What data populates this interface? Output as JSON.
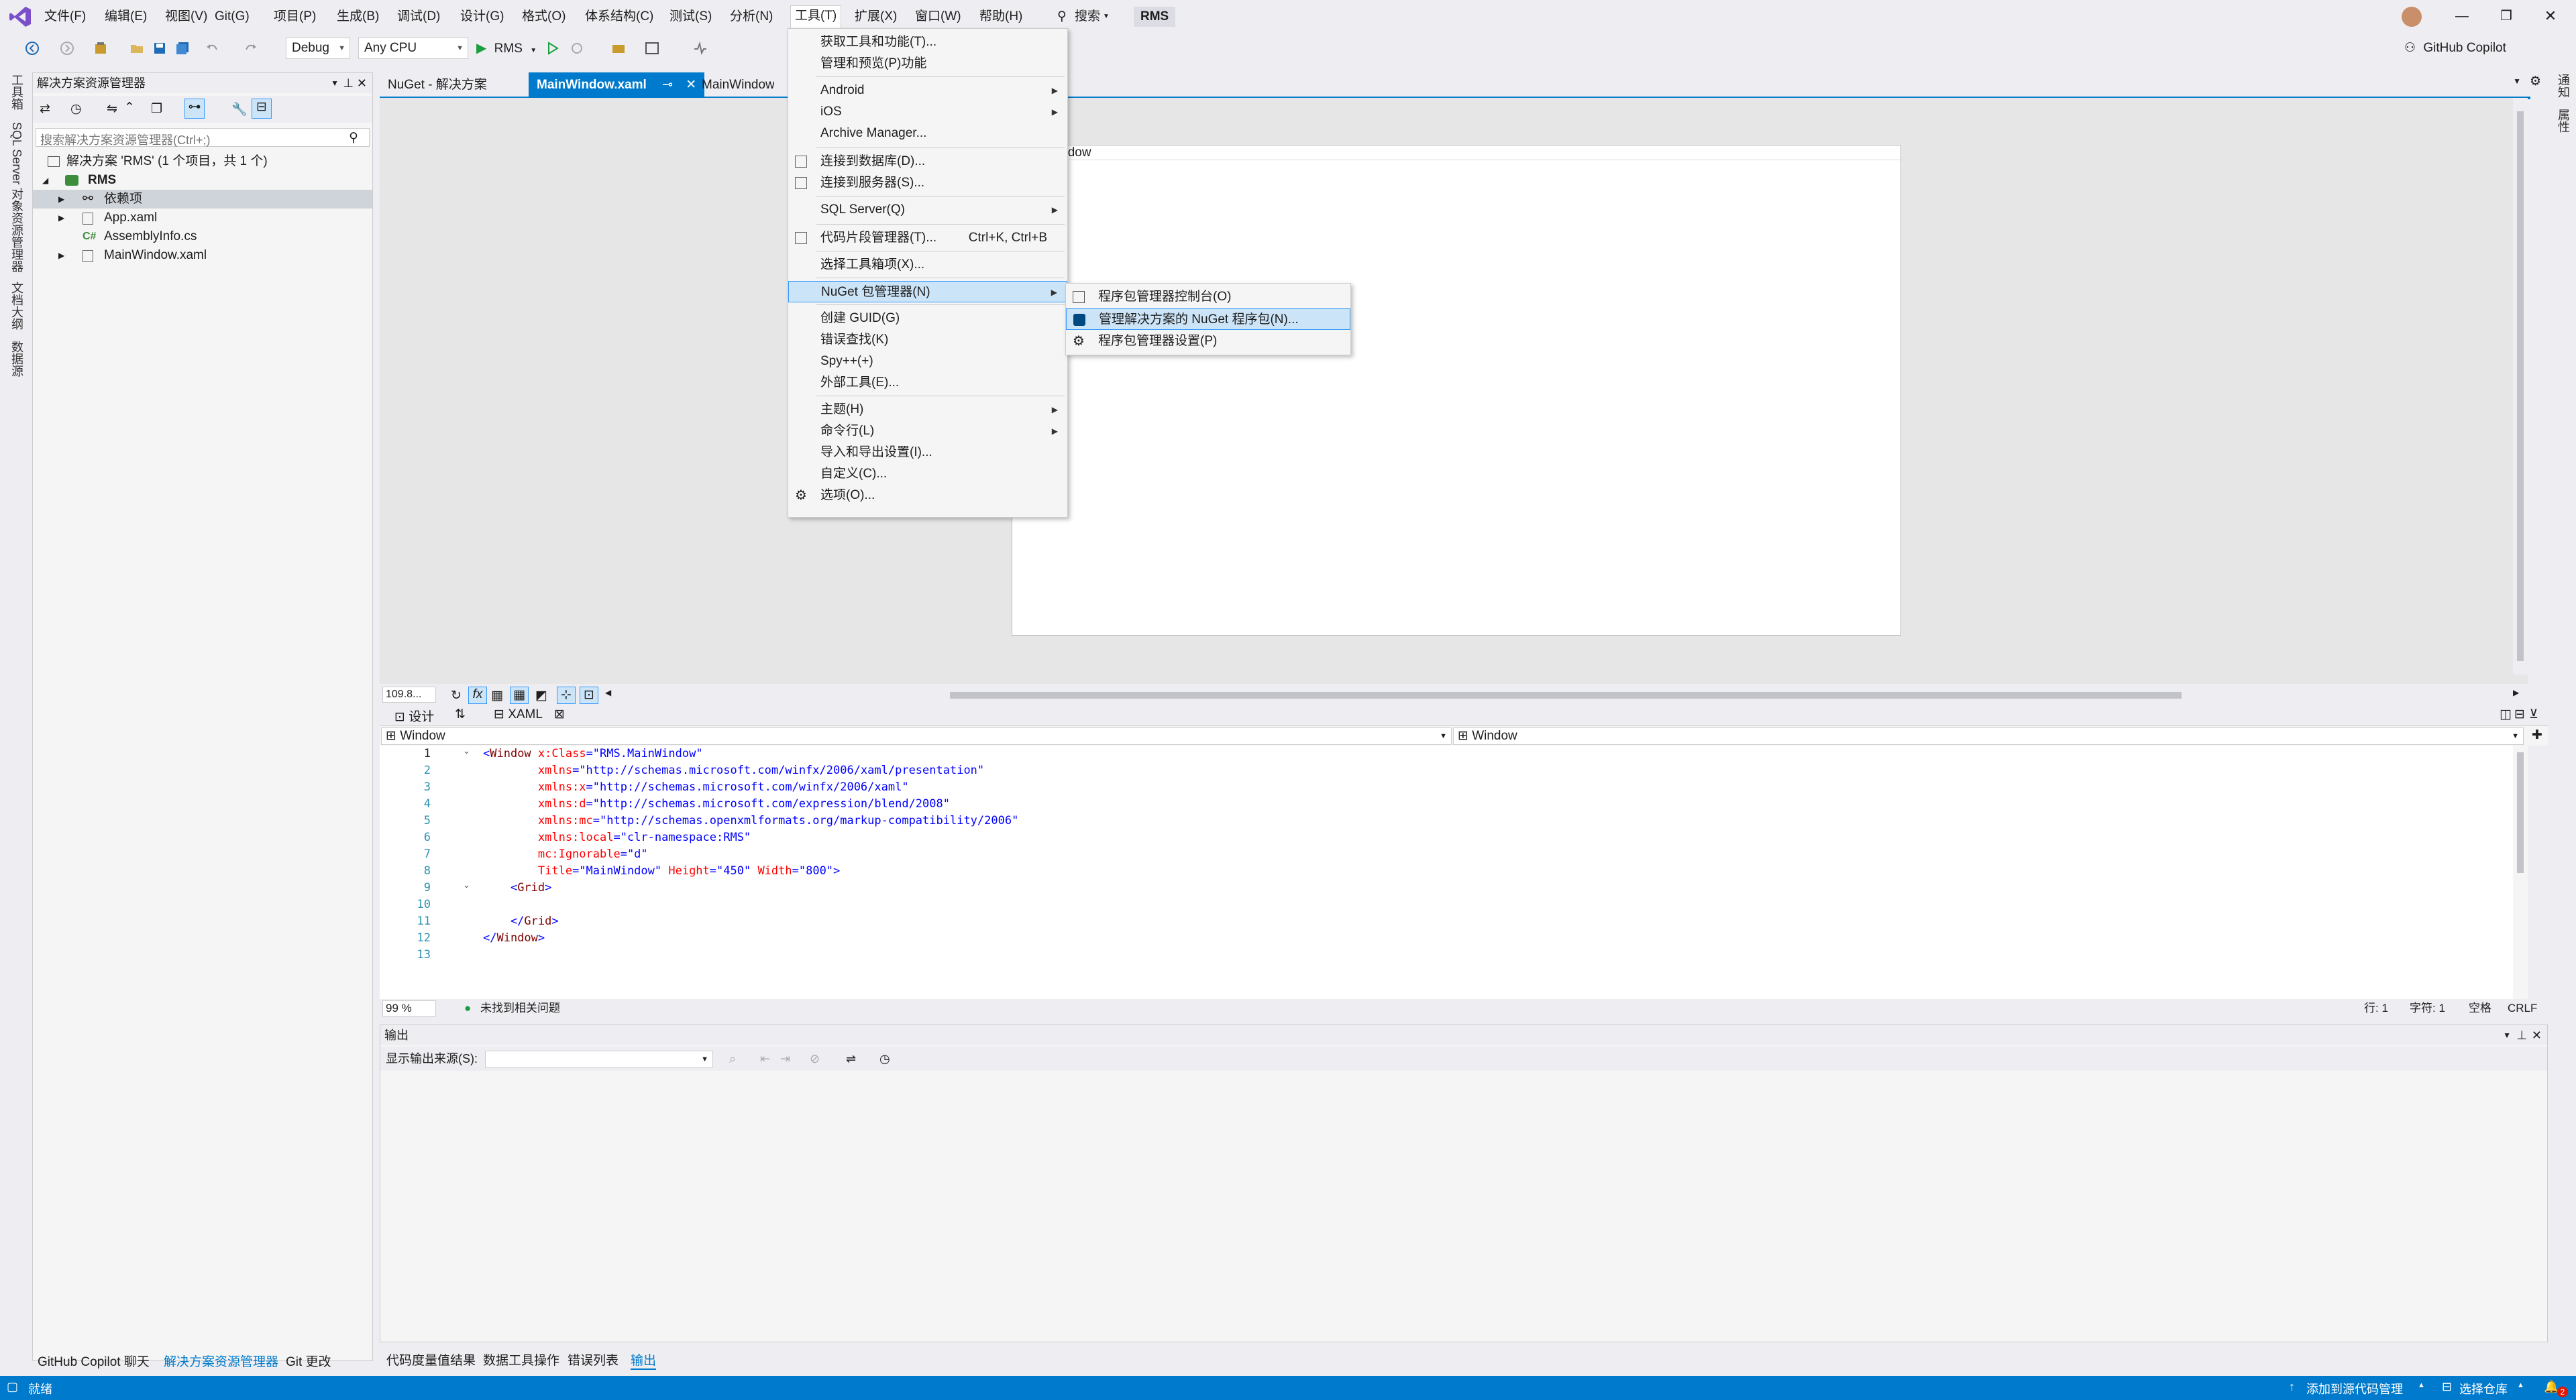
{
  "menubar": {
    "items": [
      "文件(F)",
      "编辑(E)",
      "视图(V)",
      "Git(G)",
      "项目(P)",
      "生成(B)",
      "调试(D)",
      "设计(G)",
      "格式(O)",
      "体系结构(C)",
      "测试(S)",
      "分析(N)",
      "工具(T)",
      "扩展(X)",
      "窗口(W)",
      "帮助(H)"
    ],
    "search_label": "搜索",
    "solution_name": "RMS",
    "copilot_label": "GitHub Copilot"
  },
  "toolbar": {
    "config": "Debug",
    "platform": "Any CPU",
    "run_label": "RMS"
  },
  "left_strip": {
    "tabs": [
      "工具箱",
      "SQL Server 对象资源管理器",
      "文档大纲",
      "数据源"
    ]
  },
  "right_strip": {
    "tabs": [
      "通知",
      "属性"
    ]
  },
  "solution_explorer": {
    "title": "解决方案资源管理器",
    "search_placeholder": "搜索解决方案资源管理器(Ctrl+;)",
    "solution_row": "解决方案 'RMS' (1 个项目，共 1 个)",
    "project": "RMS",
    "items": [
      "依赖项",
      "App.xaml",
      "AssemblyInfo.cs",
      "MainWindow.xaml"
    ],
    "bottom_tabs": [
      "GitHub Copilot 聊天",
      "解决方案资源管理器",
      "Git 更改"
    ]
  },
  "doc_tabs": [
    {
      "label": "NuGet - 解决方案"
    },
    {
      "label": "MainWindow.xaml"
    },
    {
      "label": "MainWindow.x"
    }
  ],
  "designer": {
    "window_title": "Window",
    "zoom": "109.8...",
    "view_design": "设计",
    "view_xaml": "XAML"
  },
  "code_editor": {
    "left_combo": "Window",
    "right_combo": "Window",
    "lines": [
      {
        "n": "1",
        "parts": [
          [
            "t-bl",
            "<"
          ],
          [
            "t-k",
            "Window "
          ],
          [
            "t-r",
            "x:Class"
          ],
          [
            "t-bl",
            "=\"RMS.MainWindow\""
          ]
        ]
      },
      {
        "n": "2",
        "parts": [
          [
            "t-r",
            "        xmlns"
          ],
          [
            "t-bl",
            "=\"http://schemas.microsoft.com/winfx/2006/xaml/presentation\""
          ]
        ]
      },
      {
        "n": "3",
        "parts": [
          [
            "t-r",
            "        xmlns:x"
          ],
          [
            "t-bl",
            "=\"http://schemas.microsoft.com/winfx/2006/xaml\""
          ]
        ]
      },
      {
        "n": "4",
        "parts": [
          [
            "t-r",
            "        xmlns:d"
          ],
          [
            "t-bl",
            "=\"http://schemas.microsoft.com/expression/blend/2008\""
          ]
        ]
      },
      {
        "n": "5",
        "parts": [
          [
            "t-r",
            "        xmlns:mc"
          ],
          [
            "t-bl",
            "=\"http://schemas.openxmlformats.org/markup-compatibility/2006\""
          ]
        ]
      },
      {
        "n": "6",
        "parts": [
          [
            "t-r",
            "        xmlns:local"
          ],
          [
            "t-bl",
            "=\"clr-namespace:RMS\""
          ]
        ]
      },
      {
        "n": "7",
        "parts": [
          [
            "t-r",
            "        mc:Ignorable"
          ],
          [
            "t-bl",
            "=\"d\""
          ]
        ]
      },
      {
        "n": "8",
        "parts": [
          [
            "t-r",
            "        Title"
          ],
          [
            "t-bl",
            "=\"MainWindow\" "
          ],
          [
            "t-r",
            "Height"
          ],
          [
            "t-bl",
            "=\"450\" "
          ],
          [
            "t-r",
            "Width"
          ],
          [
            "t-bl",
            "=\"800\">"
          ]
        ]
      },
      {
        "n": "9",
        "parts": [
          [
            "t-bl",
            "    <"
          ],
          [
            "t-k",
            "Grid"
          ],
          [
            "t-bl",
            ">"
          ]
        ]
      },
      {
        "n": "10",
        "parts": []
      },
      {
        "n": "11",
        "parts": [
          [
            "t-bl",
            "    </"
          ],
          [
            "t-k",
            "Grid"
          ],
          [
            "t-bl",
            ">"
          ]
        ]
      },
      {
        "n": "12",
        "parts": [
          [
            "t-bl",
            "</"
          ],
          [
            "t-k",
            "Window"
          ],
          [
            "t-bl",
            ">"
          ]
        ]
      },
      {
        "n": "13",
        "parts": []
      }
    ],
    "zoom": "99 %",
    "status": "未找到相关问题",
    "row": "行: 1",
    "col": "字符: 1",
    "ws": "空格",
    "eol": "CRLF"
  },
  "output": {
    "title": "输出",
    "source_label": "显示输出来源(S):",
    "bottom_tabs": [
      "代码度量值结果",
      "数据工具操作",
      "错误列表",
      "输出"
    ]
  },
  "tools_menu": {
    "items": [
      {
        "label": "获取工具和功能(T)...",
        "icon": "",
        "shortcut": "",
        "sub": false
      },
      {
        "label": "管理和预览(P)功能",
        "icon": "",
        "shortcut": "",
        "sub": false
      },
      {
        "sep": true
      },
      {
        "label": "Android",
        "icon": "",
        "shortcut": "",
        "sub": true
      },
      {
        "label": "iOS",
        "icon": "",
        "shortcut": "",
        "sub": true
      },
      {
        "label": "Archive Manager...",
        "icon": "",
        "shortcut": "",
        "sub": false
      },
      {
        "sep": true
      },
      {
        "label": "连接到数据库(D)...",
        "icon": "db-connect-icon",
        "shortcut": "",
        "sub": false
      },
      {
        "label": "连接到服务器(S)...",
        "icon": "server-connect-icon",
        "shortcut": "",
        "sub": false
      },
      {
        "sep": true
      },
      {
        "label": "SQL Server(Q)",
        "icon": "",
        "shortcut": "",
        "sub": true
      },
      {
        "sep": true
      },
      {
        "label": "代码片段管理器(T)...",
        "icon": "snippet-icon",
        "shortcut": "Ctrl+K, Ctrl+B",
        "sub": false
      },
      {
        "sep": true
      },
      {
        "label": "选择工具箱项(X)...",
        "icon": "",
        "shortcut": "",
        "sub": false
      },
      {
        "sep": true
      },
      {
        "label": "NuGet 包管理器(N)",
        "icon": "",
        "shortcut": "",
        "sub": true,
        "active": true
      },
      {
        "sep": true
      },
      {
        "label": "创建 GUID(G)",
        "icon": "",
        "shortcut": "",
        "sub": false
      },
      {
        "label": "错误查找(K)",
        "icon": "",
        "shortcut": "",
        "sub": false
      },
      {
        "label": "Spy++(+)",
        "icon": "",
        "shortcut": "",
        "sub": false
      },
      {
        "label": "外部工具(E)...",
        "icon": "",
        "shortcut": "",
        "sub": false
      },
      {
        "sep": true
      },
      {
        "label": "主题(H)",
        "icon": "",
        "shortcut": "",
        "sub": true
      },
      {
        "label": "命令行(L)",
        "icon": "",
        "shortcut": "",
        "sub": true
      },
      {
        "label": "导入和导出设置(I)...",
        "icon": "",
        "shortcut": "",
        "sub": false
      },
      {
        "label": "自定义(C)...",
        "icon": "",
        "shortcut": "",
        "sub": false
      },
      {
        "label": "选项(O)...",
        "icon": "gear-icon",
        "shortcut": "",
        "sub": false
      }
    ]
  },
  "nuget_submenu": {
    "items": [
      {
        "label": "程序包管理器控制台(O)",
        "icon": "console-icon"
      },
      {
        "label": "管理解决方案的 NuGet 程序包(N)...",
        "icon": "nuget-icon",
        "active": true
      },
      {
        "label": "程序包管理器设置(P)",
        "icon": "gear-icon"
      }
    ]
  },
  "statusbar": {
    "ready": "就绪",
    "add_source": "添加到源代码管理",
    "select_repo": "选择仓库",
    "notif_count": "2"
  },
  "colors": {
    "accent": "#007acc",
    "tab_active": "#007acc",
    "menu_highlight": "#cce4f7"
  }
}
